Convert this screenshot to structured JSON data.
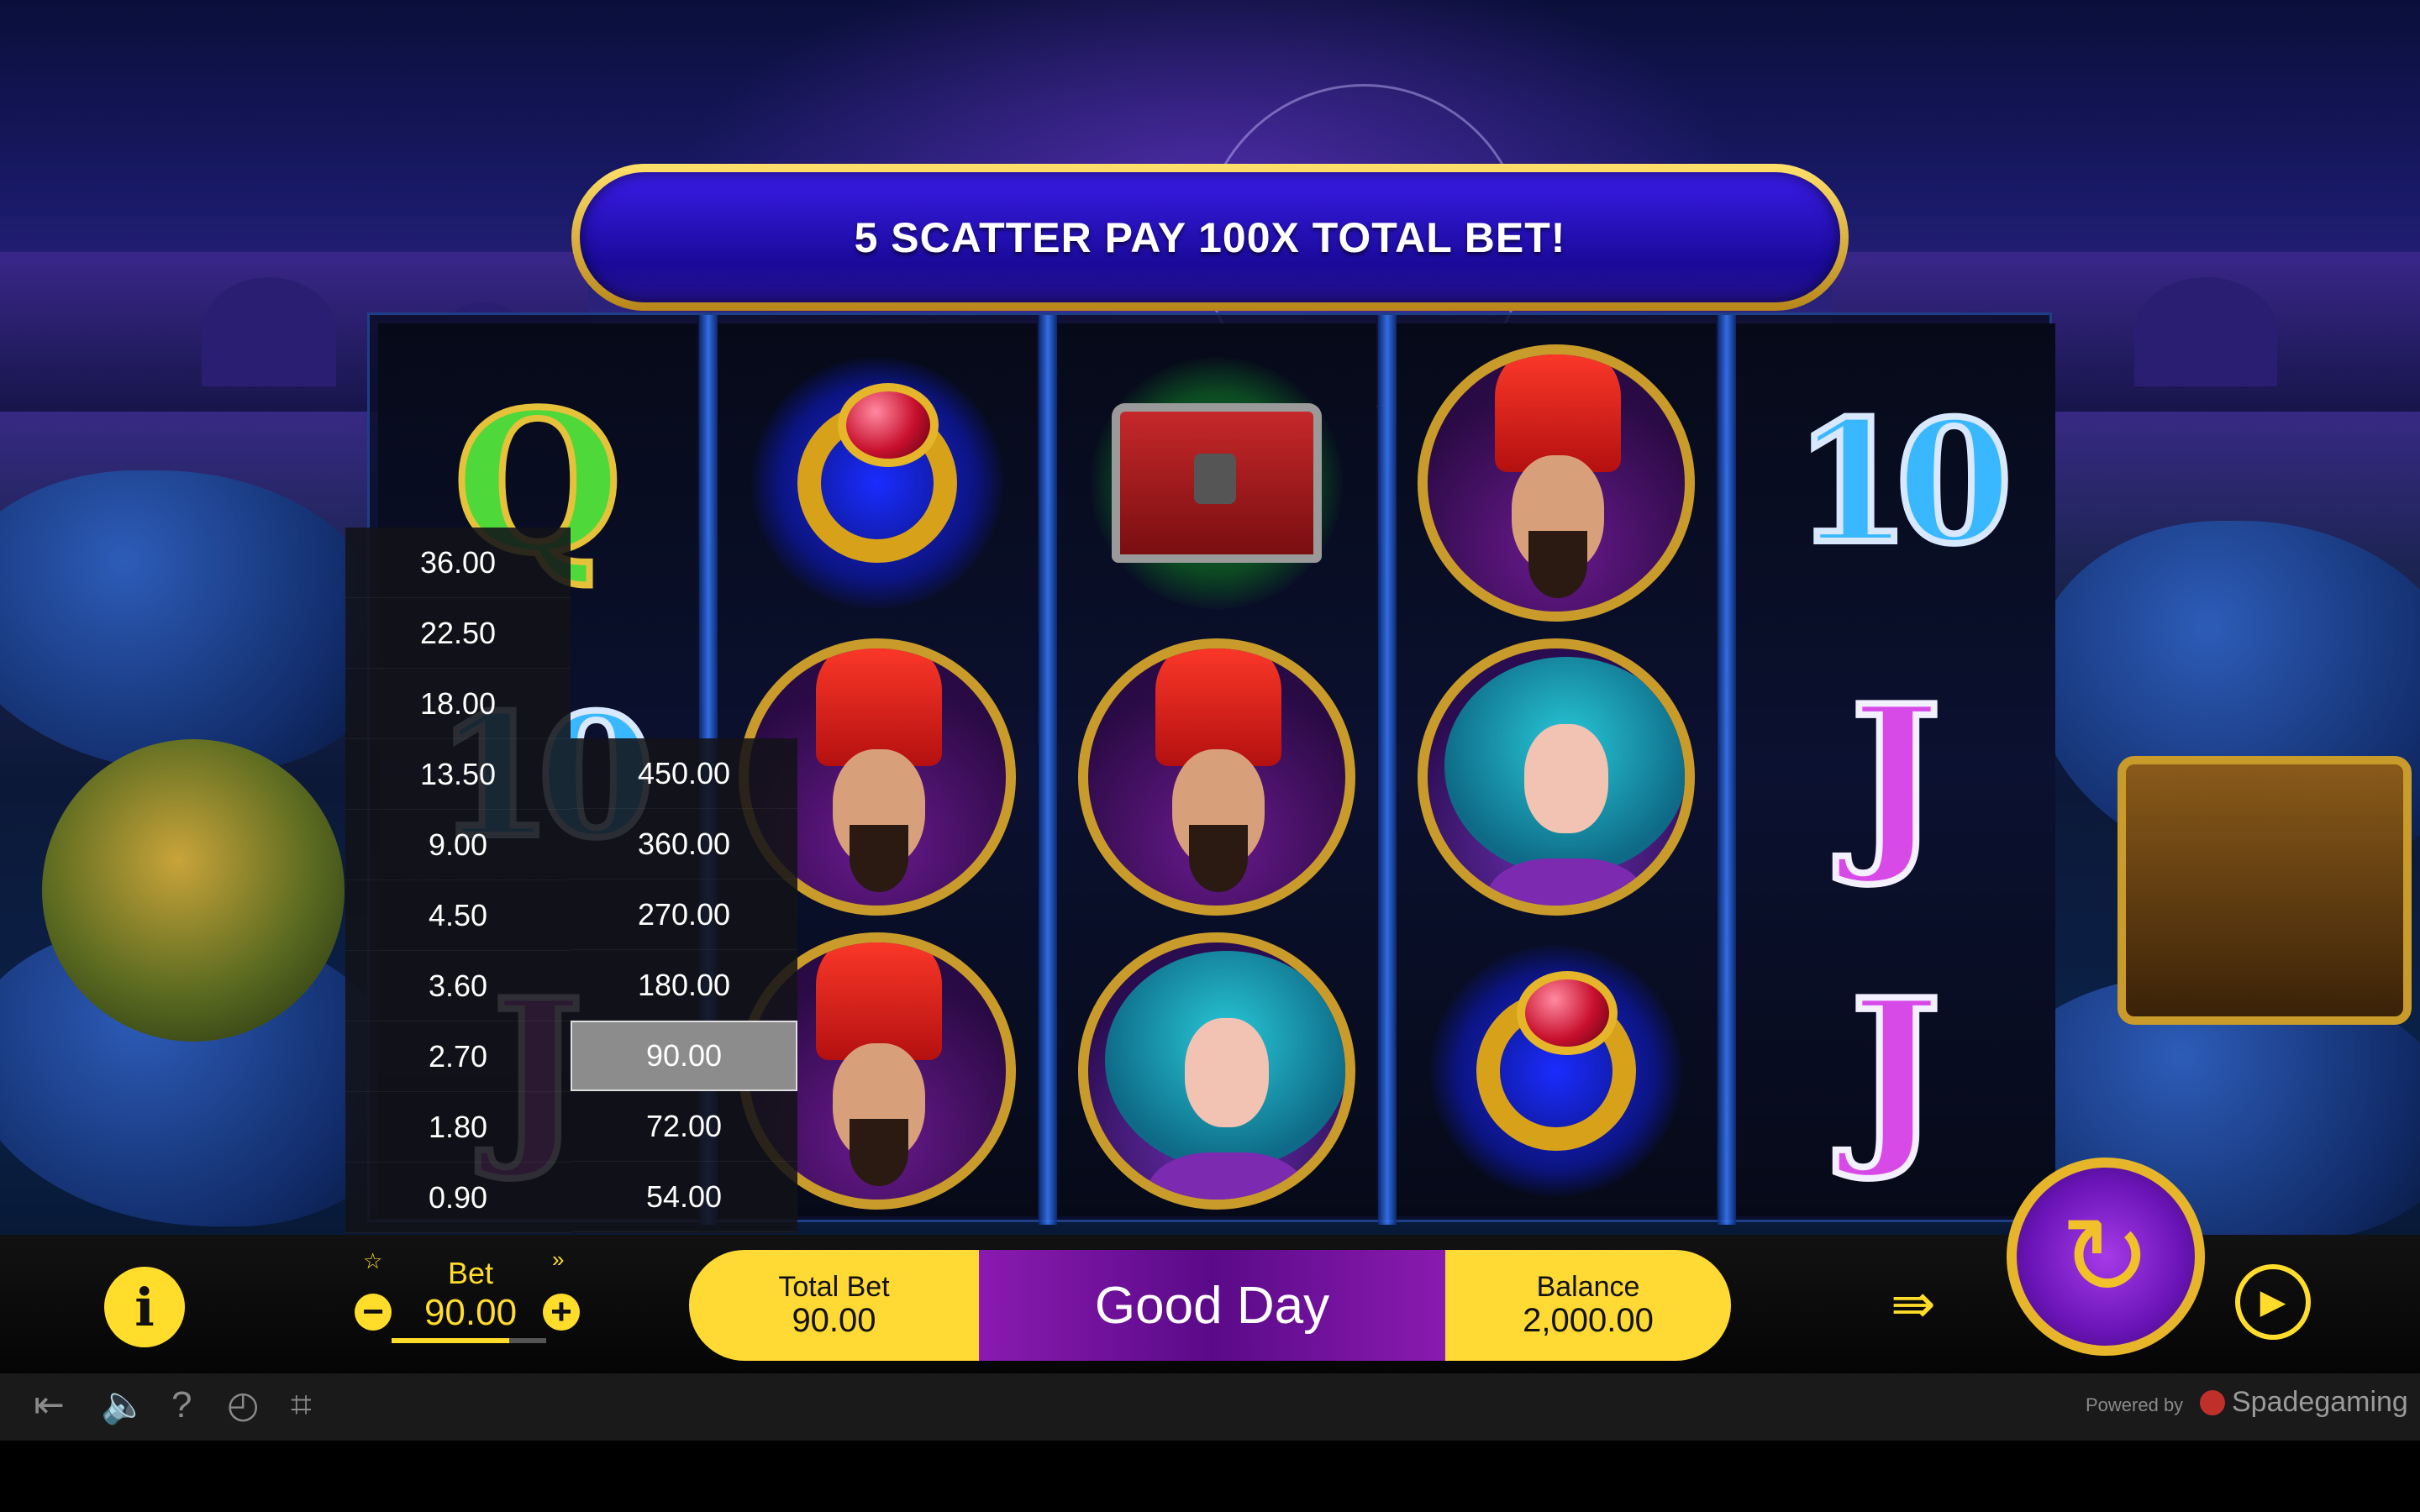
{
  "banner": {
    "text": "5 SCATTER PAY 100X TOTAL BET!"
  },
  "reels": [
    {
      "symbols": [
        "Q",
        "10",
        "J"
      ]
    },
    {
      "symbols": [
        "ring",
        "vizier",
        "vizier"
      ]
    },
    {
      "symbols": [
        "treasure-chest",
        "vizier",
        "lady"
      ]
    },
    {
      "symbols": [
        "vizier",
        "lady",
        "ring"
      ]
    },
    {
      "symbols": [
        "10",
        "J",
        "J"
      ]
    }
  ],
  "symbol_text": {
    "q": "Q",
    "ten": "10",
    "j": "J"
  },
  "bet_options": {
    "column1": [
      "36.00",
      "22.50",
      "18.00",
      "13.50",
      "9.00",
      "4.50",
      "3.60",
      "2.70",
      "1.80",
      "0.90"
    ],
    "column2": [
      "450.00",
      "360.00",
      "270.00",
      "180.00",
      "90.00",
      "72.00",
      "54.00"
    ],
    "selected": "90.00"
  },
  "bet_control": {
    "label": "Bet",
    "value": "90.00",
    "minus": "−",
    "plus": "+",
    "favorite_icon": "star-icon",
    "expand_icon": "double-chevron-down-icon"
  },
  "status": {
    "total_bet_label": "Total Bet",
    "total_bet_value": "90.00",
    "message": "Good Day",
    "balance_label": "Balance",
    "balance_value": "2,000.00"
  },
  "controls": {
    "info_icon": "info-icon",
    "spin_icon": "spin-icon",
    "turbo_icon": "turbo-icon",
    "autoplay_icon": "autoplay-icon"
  },
  "footer": {
    "icons": [
      "exit-icon",
      "sound-icon",
      "help-icon",
      "history-icon",
      "fullscreen-icon"
    ],
    "powered_by": "Powered by",
    "brand": "Spadegaming"
  },
  "colors": {
    "accent_yellow": "#ffd934",
    "status_purple": "#5a0a88",
    "banner_blue": "#1a0a9a",
    "gold_frame": "#c99b2a"
  }
}
